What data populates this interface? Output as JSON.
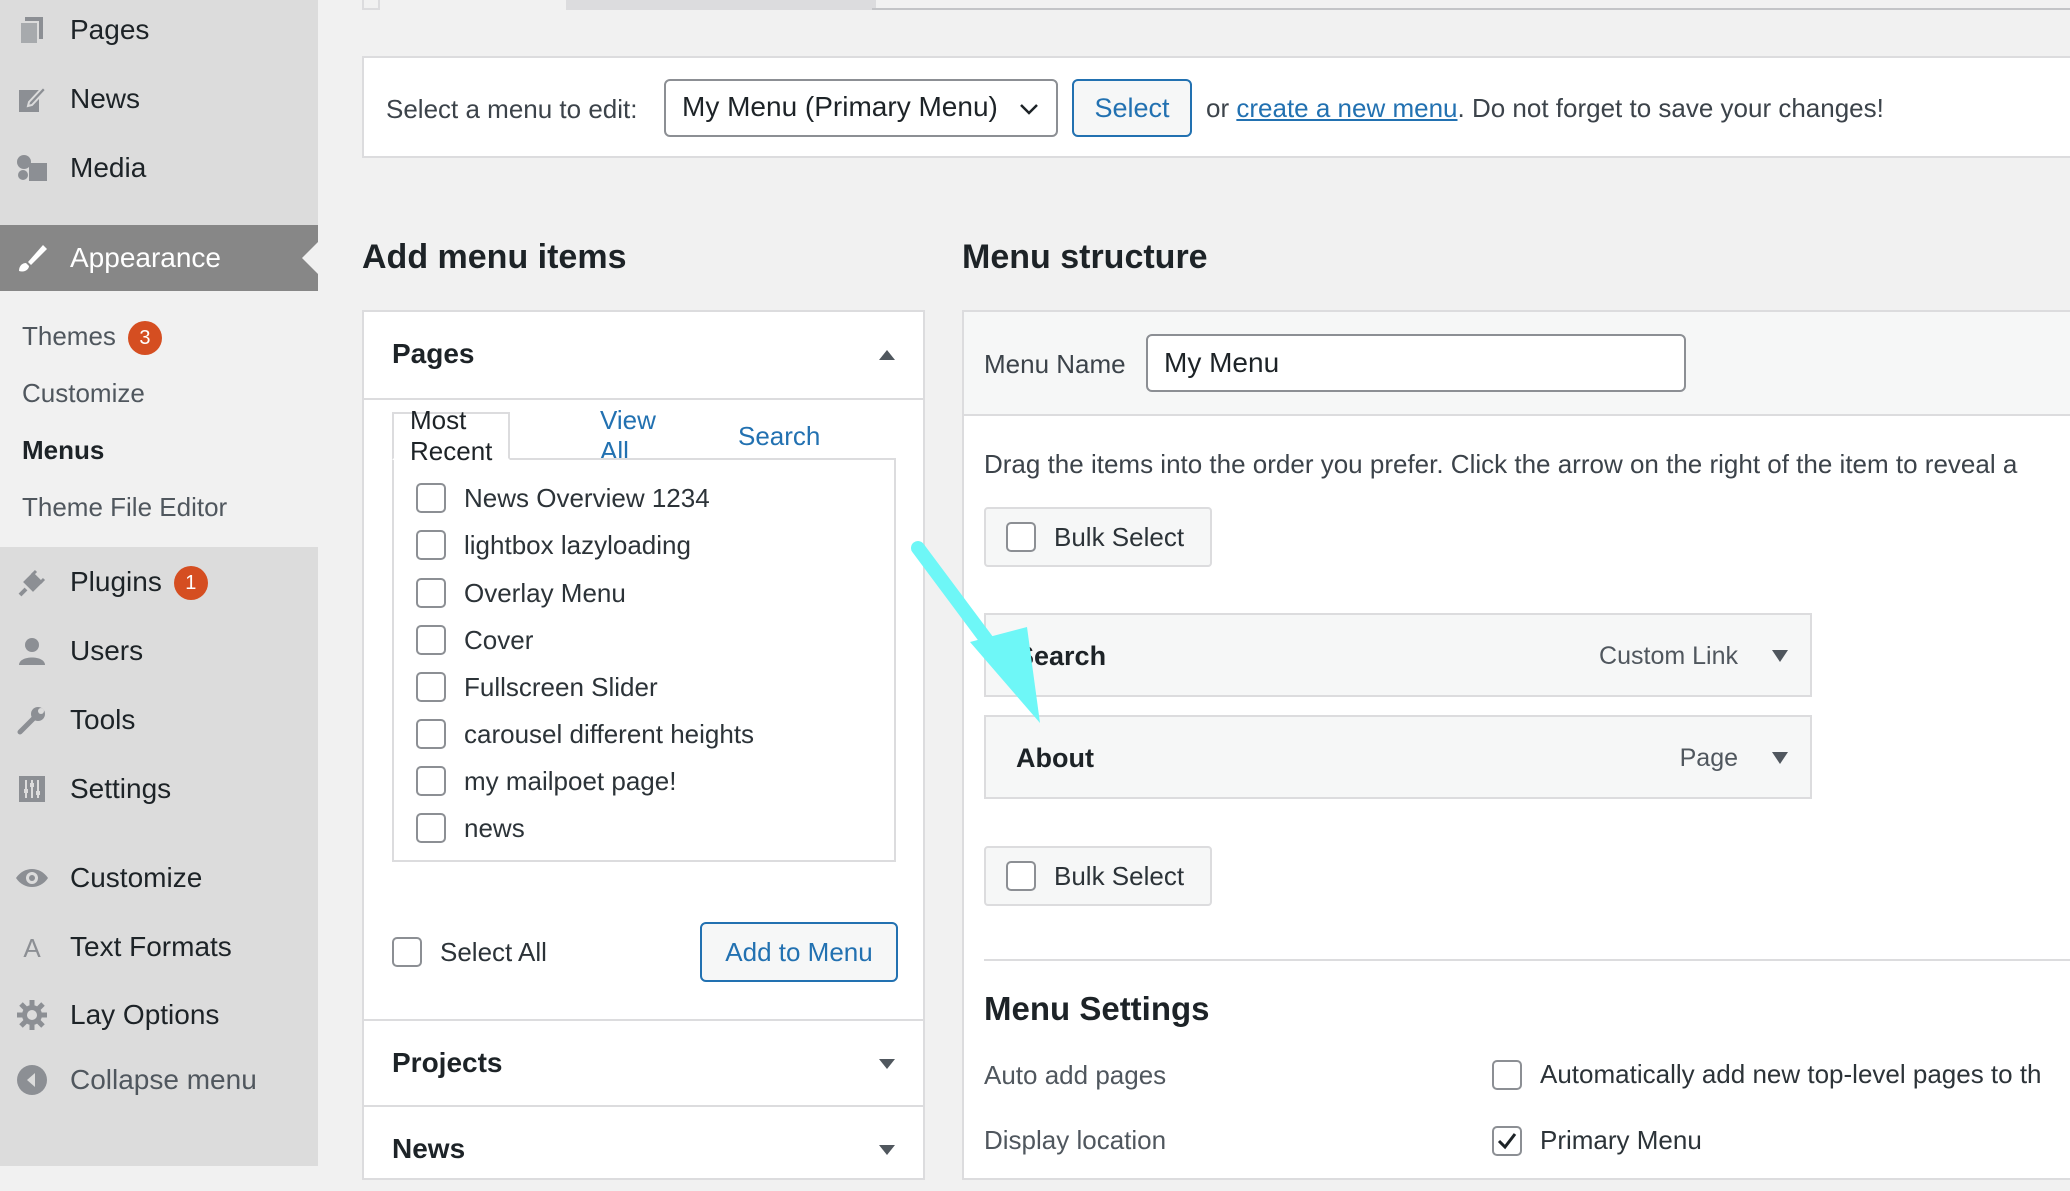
{
  "sidebar": {
    "top_items": [
      {
        "label": "Pages",
        "icon": "pages-icon"
      },
      {
        "label": "News",
        "icon": "news-icon"
      },
      {
        "label": "Media",
        "icon": "media-icon"
      }
    ],
    "appearance": {
      "label": "Appearance",
      "icon": "paintbrush-icon"
    },
    "submenu": [
      {
        "label": "Themes",
        "badge": "3"
      },
      {
        "label": "Customize"
      },
      {
        "label": "Menus",
        "current": true
      },
      {
        "label": "Theme File Editor"
      }
    ],
    "bottom_items": [
      {
        "label": "Plugins",
        "icon": "plugin-icon",
        "badge": "1"
      },
      {
        "label": "Users",
        "icon": "users-icon"
      },
      {
        "label": "Tools",
        "icon": "wrench-icon"
      },
      {
        "label": "Settings",
        "icon": "settings-icon"
      },
      {
        "label": "Customize",
        "icon": "eye-icon"
      },
      {
        "label": "Text Formats",
        "icon": "text-format-icon"
      },
      {
        "label": "Lay Options",
        "icon": "gear-icon"
      },
      {
        "label": "Collapse menu",
        "icon": "collapse-icon"
      }
    ]
  },
  "select_menu": {
    "label": "Select a menu to edit:",
    "selected": "My Menu (Primary Menu)",
    "select_button": "Select",
    "or_text": "or",
    "create_link": "create a new menu",
    "after_text": ". Do not forget to save your changes!"
  },
  "add_items": {
    "heading": "Add menu items",
    "pages_title": "Pages",
    "tabs": [
      "Most Recent",
      "View All",
      "Search"
    ],
    "pages": [
      "News Overview 1234",
      "lightbox lazyloading",
      "Overlay Menu",
      "Cover",
      "Fullscreen Slider",
      "carousel different heights",
      "my mailpoet page!",
      "news"
    ],
    "select_all": "Select All",
    "add_button": "Add to Menu",
    "projects_title": "Projects",
    "news_title": "News"
  },
  "structure": {
    "heading": "Menu structure",
    "name_label": "Menu Name",
    "name_value": "My Menu",
    "instructions": "Drag the items into the order you prefer. Click the arrow on the right of the item to reveal a",
    "bulk_select": "Bulk Select",
    "items": [
      {
        "title": "Search",
        "type": "Custom Link"
      },
      {
        "title": "About",
        "type": "Page"
      }
    ],
    "settings_heading": "Menu Settings",
    "auto_add_label": "Auto add pages",
    "auto_add_text": "Automatically add new top-level pages to th",
    "location_label": "Display location",
    "location_text": "Primary Menu"
  },
  "colors": {
    "accent": "#2271b1",
    "badge": "#d54e21",
    "annotation_arrow": "#6ef7f7"
  }
}
